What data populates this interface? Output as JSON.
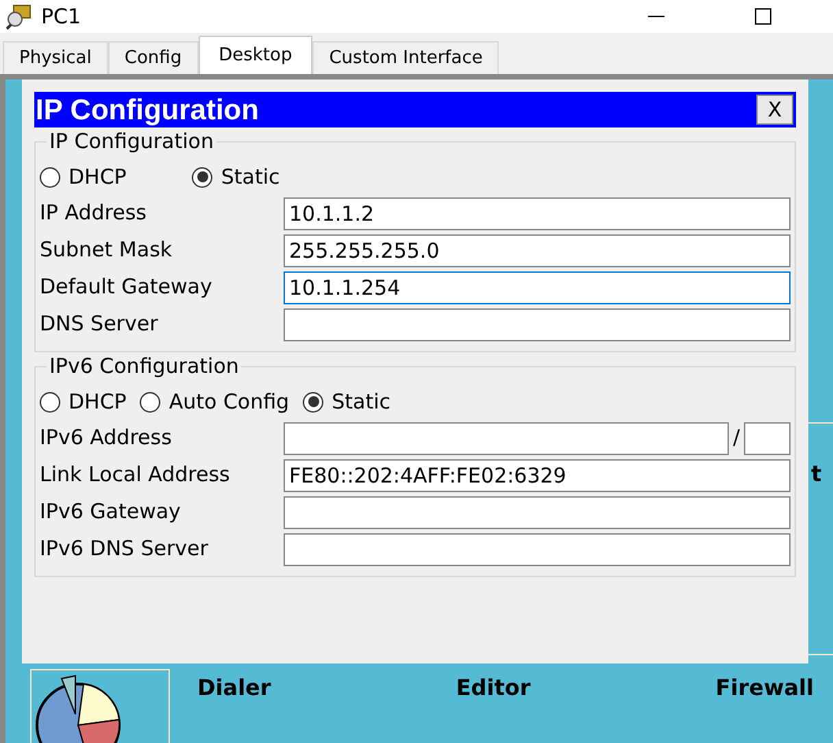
{
  "window": {
    "title": "PC1"
  },
  "tabs": [
    {
      "label": "Physical",
      "selected": false
    },
    {
      "label": "Config",
      "selected": false
    },
    {
      "label": "Desktop",
      "selected": true
    },
    {
      "label": "Custom Interface",
      "selected": false
    }
  ],
  "desktop_apps": [
    "Dialer",
    "Editor",
    "Firewall"
  ],
  "desktop_fragment": "t",
  "dialog": {
    "title": "IP Configuration",
    "close": "X",
    "ipv4": {
      "legend": "IP Configuration",
      "modes": [
        {
          "label": "DHCP",
          "selected": false
        },
        {
          "label": "Static",
          "selected": true
        }
      ],
      "fields": [
        {
          "label": "IP Address",
          "value": "10.1.1.2",
          "focused": false
        },
        {
          "label": "Subnet Mask",
          "value": "255.255.255.0",
          "focused": false
        },
        {
          "label": "Default Gateway",
          "value": "10.1.1.254",
          "focused": true
        },
        {
          "label": "DNS Server",
          "focused": false
        }
      ]
    },
    "ipv6": {
      "legend": "IPv6 Configuration",
      "modes": [
        {
          "label": "DHCP",
          "selected": false
        },
        {
          "label": "Auto Config",
          "selected": false
        },
        {
          "label": "Static",
          "selected": true
        }
      ],
      "fields": [
        {
          "label": "IPv6 Address",
          "kind": "prefixed",
          "separator": "/",
          "focused": false
        },
        {
          "label": "Link Local Address",
          "kind": "plain",
          "value": "FE80::202:4AFF:FE02:6329",
          "focused": false
        },
        {
          "label": "IPv6 Gateway",
          "kind": "plain",
          "focused": false
        },
        {
          "label": "IPv6 DNS Server",
          "kind": "plain",
          "focused": false
        }
      ]
    }
  }
}
